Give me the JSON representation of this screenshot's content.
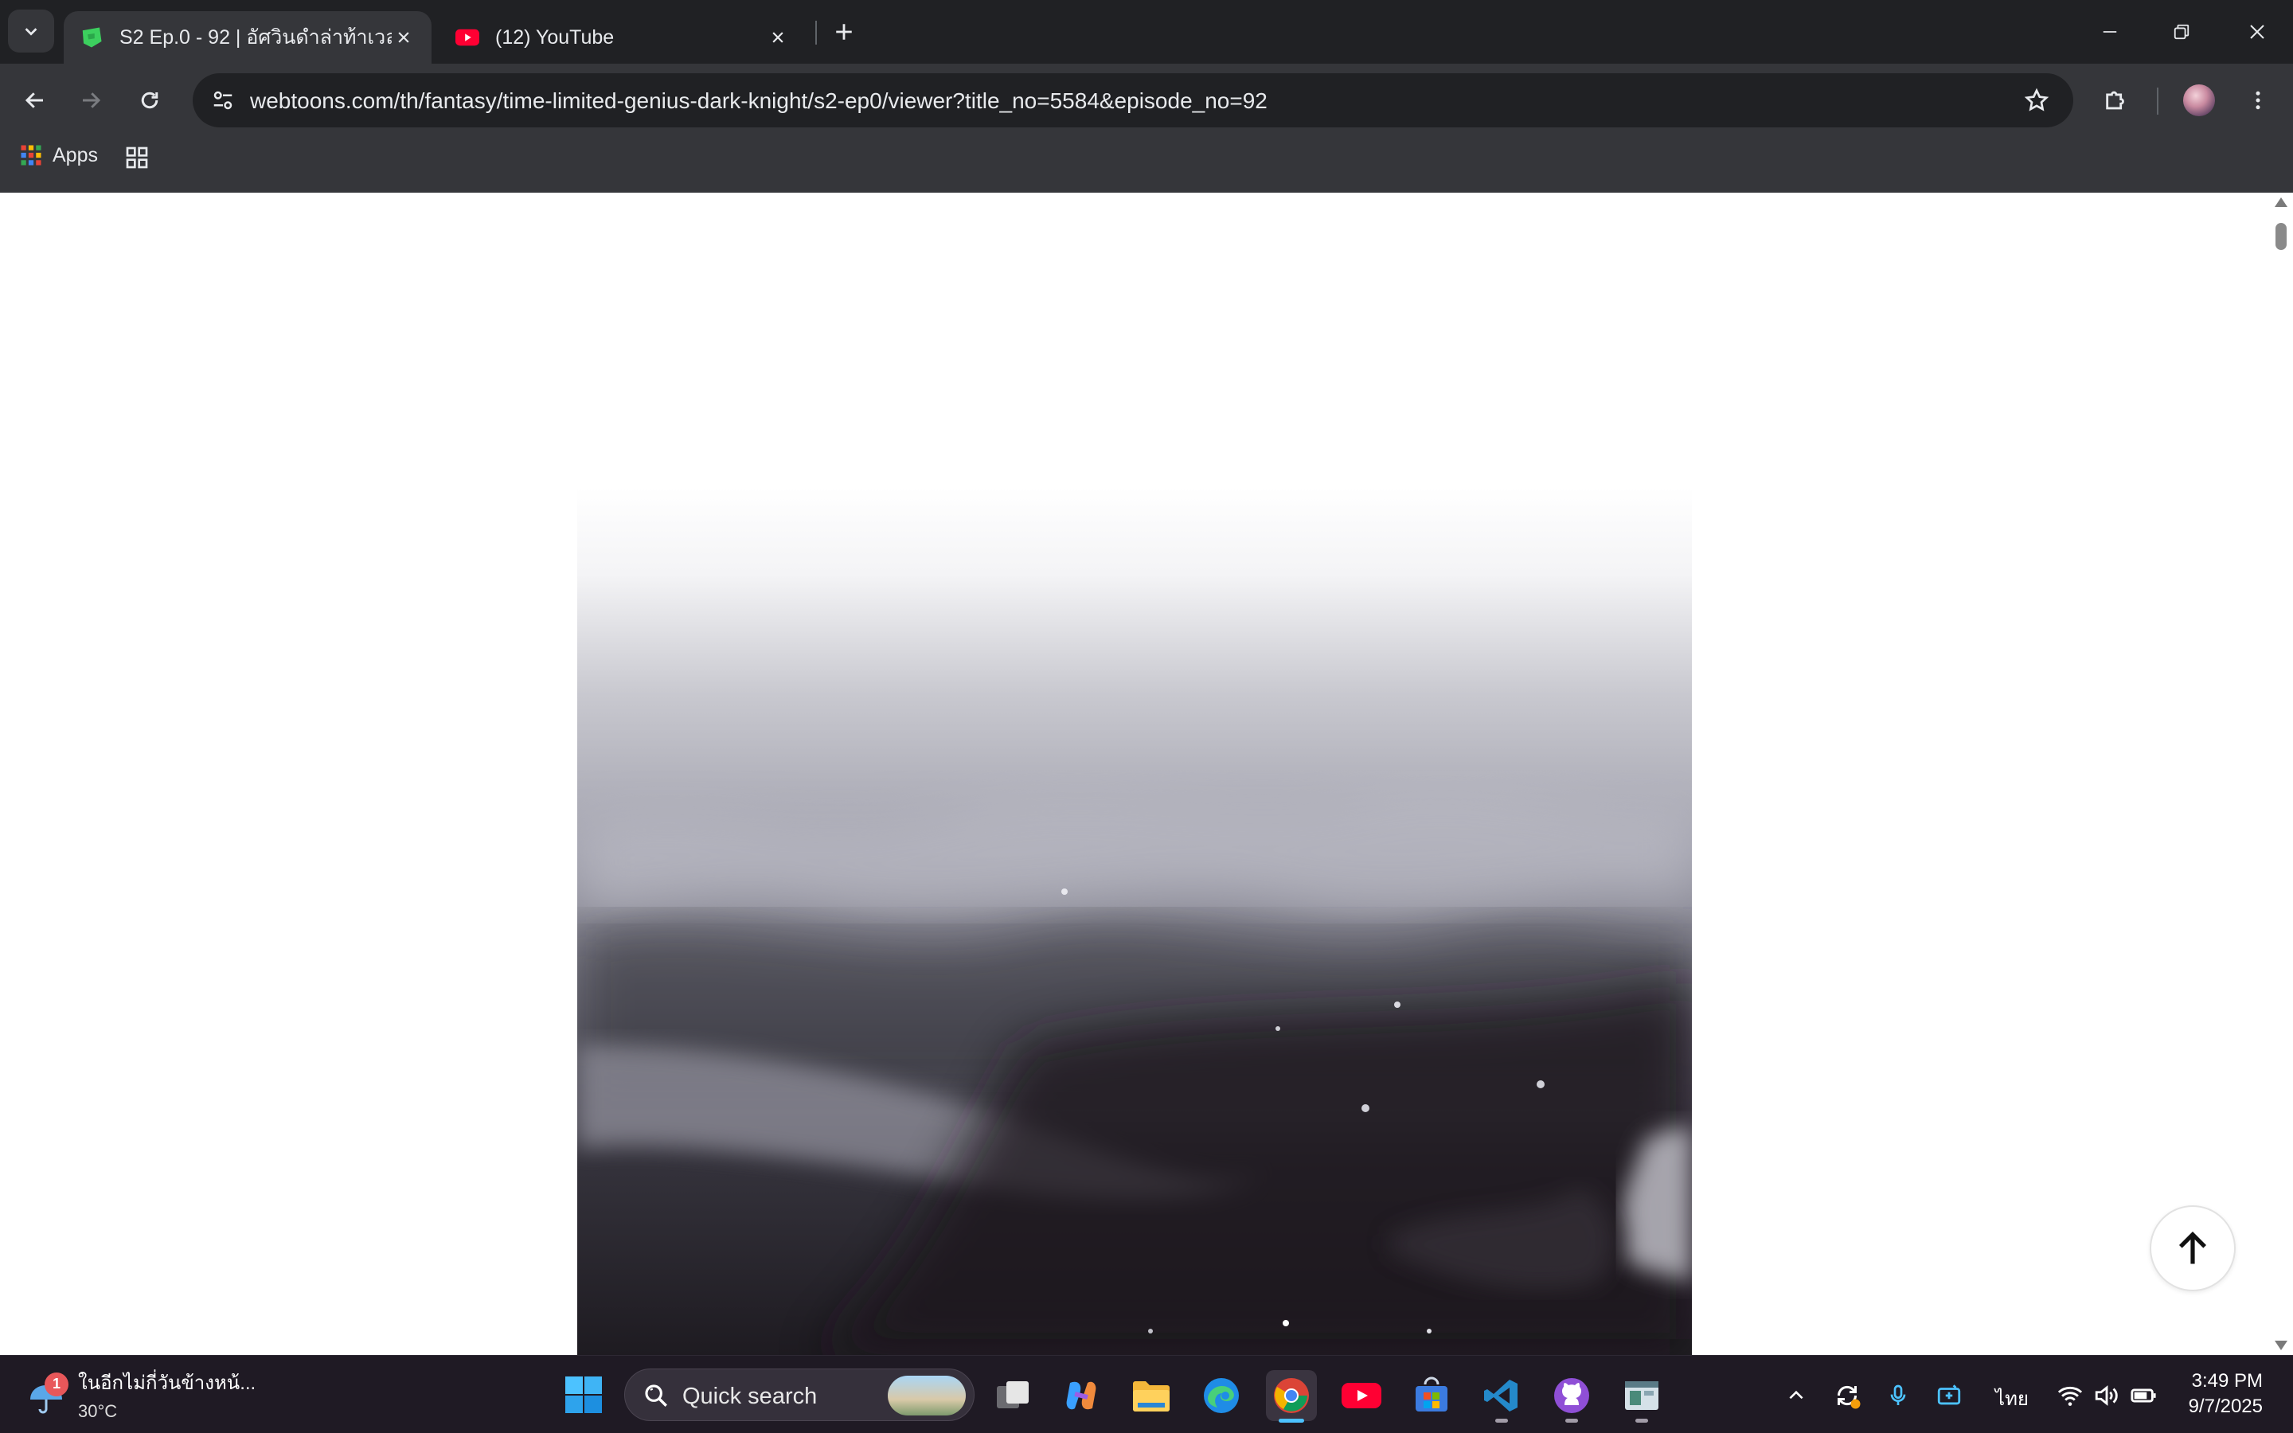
{
  "browser": {
    "tabs": [
      {
        "title": "S2 Ep.0 - 92 | อัศวินดำล่าท้าเวลา",
        "favicon": "webtoon-favicon",
        "active": true
      },
      {
        "title": "(12) YouTube",
        "favicon": "youtube-favicon",
        "active": false
      }
    ],
    "url": "webtoons.com/th/fantasy/time-limited-genius-dark-knight/s2-ep0/viewer?title_no=5584&episode_no=92",
    "bookmarks": {
      "apps_label": "Apps"
    }
  },
  "colors": {
    "titlebar": "#202124",
    "toolbar": "#35363a",
    "taskbar": "#1f1a24",
    "accent": "#4cc2ff"
  },
  "taskbar": {
    "weather": {
      "badge": "1",
      "text": "ในอีกไม่กี่วันข้างหน้...",
      "temp": "30°C"
    },
    "search_label": "Quick search",
    "language": "ไทย",
    "time": "3:49 PM",
    "date": "9/7/2025",
    "apps": [
      "task-view",
      "copilot",
      "file-explorer",
      "edge",
      "chrome",
      "youtube",
      "microsoft-store",
      "vscode",
      "github-desktop",
      "app-window"
    ]
  }
}
